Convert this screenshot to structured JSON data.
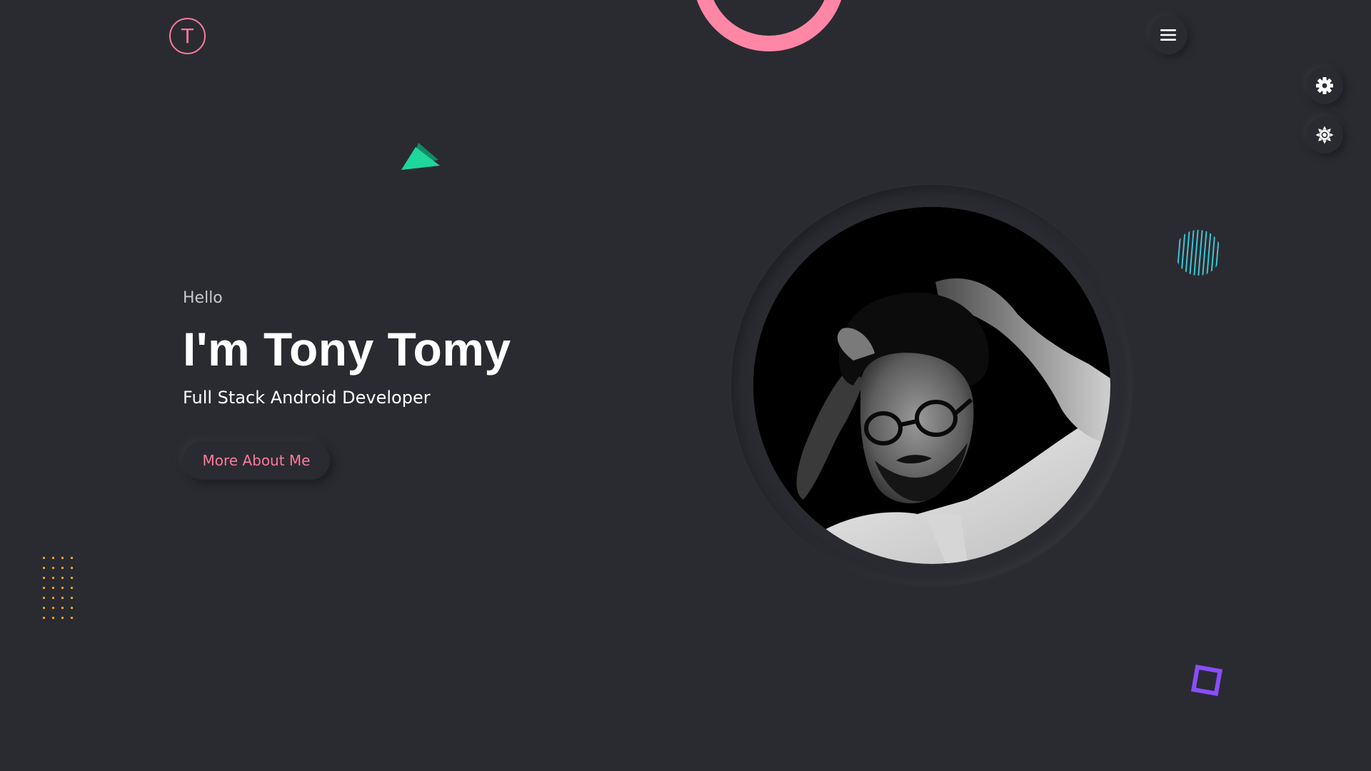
{
  "header": {
    "logo_letter": "T"
  },
  "hero": {
    "greeting": "Hello",
    "name": "I'm Tony Tomy",
    "role": "Full Stack Android Developer",
    "cta_label": "More About Me"
  },
  "icons": {
    "menu": "hamburger-icon",
    "settings": "gear-icon",
    "theme": "sun-icon"
  },
  "colors": {
    "background": "#2a2b30",
    "accent_pink": "#ff7a9c",
    "accent_green": "#1ed79a",
    "accent_cyan": "#3fc4d4",
    "accent_orange": "#f0a020",
    "accent_purple": "#8a4dff"
  }
}
